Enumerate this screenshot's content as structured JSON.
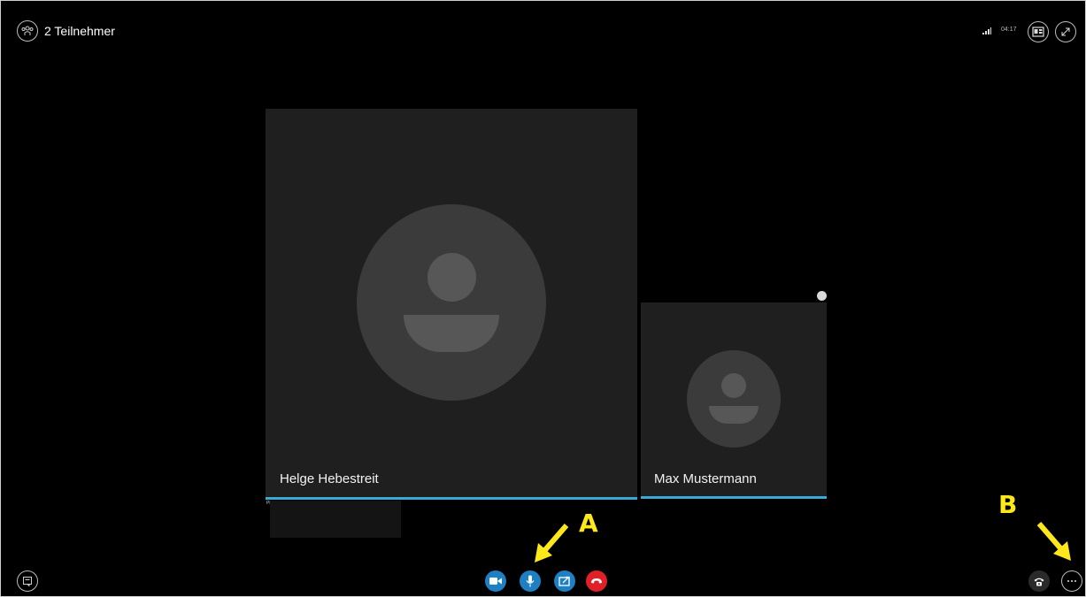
{
  "header": {
    "participants_label": "2 Teilnehmer",
    "participants_icon": "people-icon",
    "call_timer": "04:17",
    "signal_icon": "signal-bars-icon",
    "layout_icon": "layout-icon",
    "fullscreen_icon": "expand-icon"
  },
  "tiles": {
    "main": {
      "name": "Helge Hebestreit"
    },
    "side": {
      "name": "Max Mustermann"
    },
    "pip_label": "Pl"
  },
  "controls": {
    "left": {
      "icon": "chat-icon"
    },
    "center": [
      {
        "id": "video",
        "icon": "video-camera-icon"
      },
      {
        "id": "mic",
        "icon": "microphone-icon"
      },
      {
        "id": "share",
        "icon": "share-screen-icon"
      },
      {
        "id": "hangup",
        "icon": "hang-up-icon"
      }
    ],
    "right": [
      {
        "id": "dialpad",
        "icon": "phone-dialpad-icon"
      },
      {
        "id": "more",
        "icon": "more-options-icon"
      }
    ]
  },
  "annotations": {
    "label_a": "A",
    "label_b": "B"
  },
  "colors": {
    "background": "#000000",
    "tile": "#1f1f1f",
    "accent_bar": "#3aa9d8",
    "button_blue": "#1e7fc2",
    "button_red": "#e02028",
    "annotation_yellow": "#ffe81a"
  }
}
